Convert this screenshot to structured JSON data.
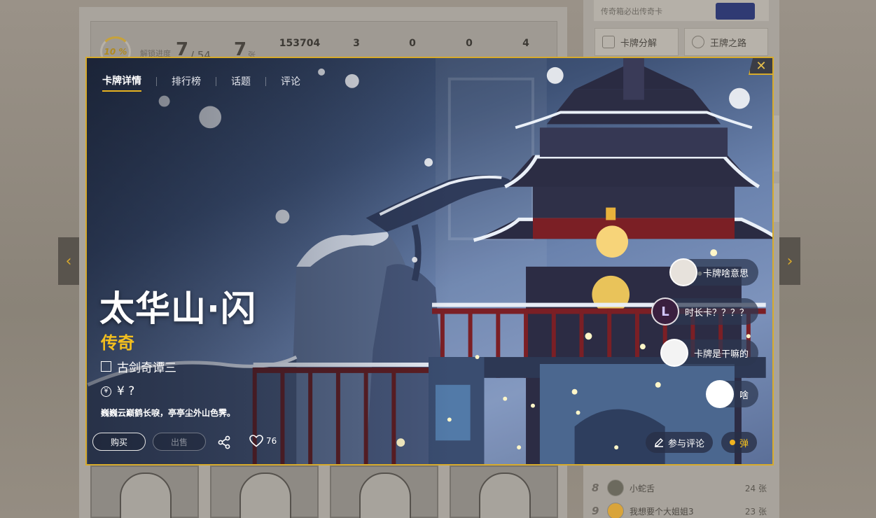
{
  "background": {
    "progress": {
      "percent": "10 %",
      "label": "解锁进度",
      "count": "7",
      "total": "/ 54"
    },
    "cards_owned": {
      "count": "7",
      "unit": "张"
    },
    "stats": [
      "153704",
      "3",
      "0",
      "0",
      "4"
    ],
    "side_banner": "传奇箱必出传奇卡",
    "side_buttons": [
      "卡牌分解",
      "王牌之路"
    ],
    "ranking": [
      {
        "no": "8",
        "name": "小蛇舌",
        "count": "24 张"
      },
      {
        "no": "9",
        "name": "我想要个大姐姐3",
        "count": "23 张"
      }
    ]
  },
  "modal": {
    "tabs": [
      "卡牌详情",
      "排行榜",
      "话题",
      "评论"
    ],
    "active_tab": 0,
    "close_icon": "close-icon",
    "card": {
      "title": "太华山·闪",
      "rarity": "传奇",
      "series": "古剑奇谭三",
      "price": "¥ ?",
      "description": "巍巍云巅鹤长唳，亭亭尘外山色霁。"
    },
    "actions": {
      "buy": "购买",
      "sell": "出售",
      "likes": "76",
      "comment": "参与评论",
      "danmu": "弹"
    },
    "comments": [
      {
        "text": "卡牌啥意思",
        "avatar": "",
        "avatar_bg": "#e7e2dc"
      },
      {
        "text": "时长卡？？？？",
        "avatar": "L",
        "avatar_bg": "#3a1f3f"
      },
      {
        "text": "卡牌是干嘛的",
        "avatar": "",
        "avatar_bg": "#f3f3f3"
      },
      {
        "text": "啥",
        "avatar": "",
        "avatar_bg": "#ffffff"
      }
    ],
    "colors": {
      "accent": "#d7ab2c",
      "rarity": "#f3bf1e"
    }
  },
  "nav": {
    "prev_icon": "‹",
    "next_icon": "›"
  }
}
